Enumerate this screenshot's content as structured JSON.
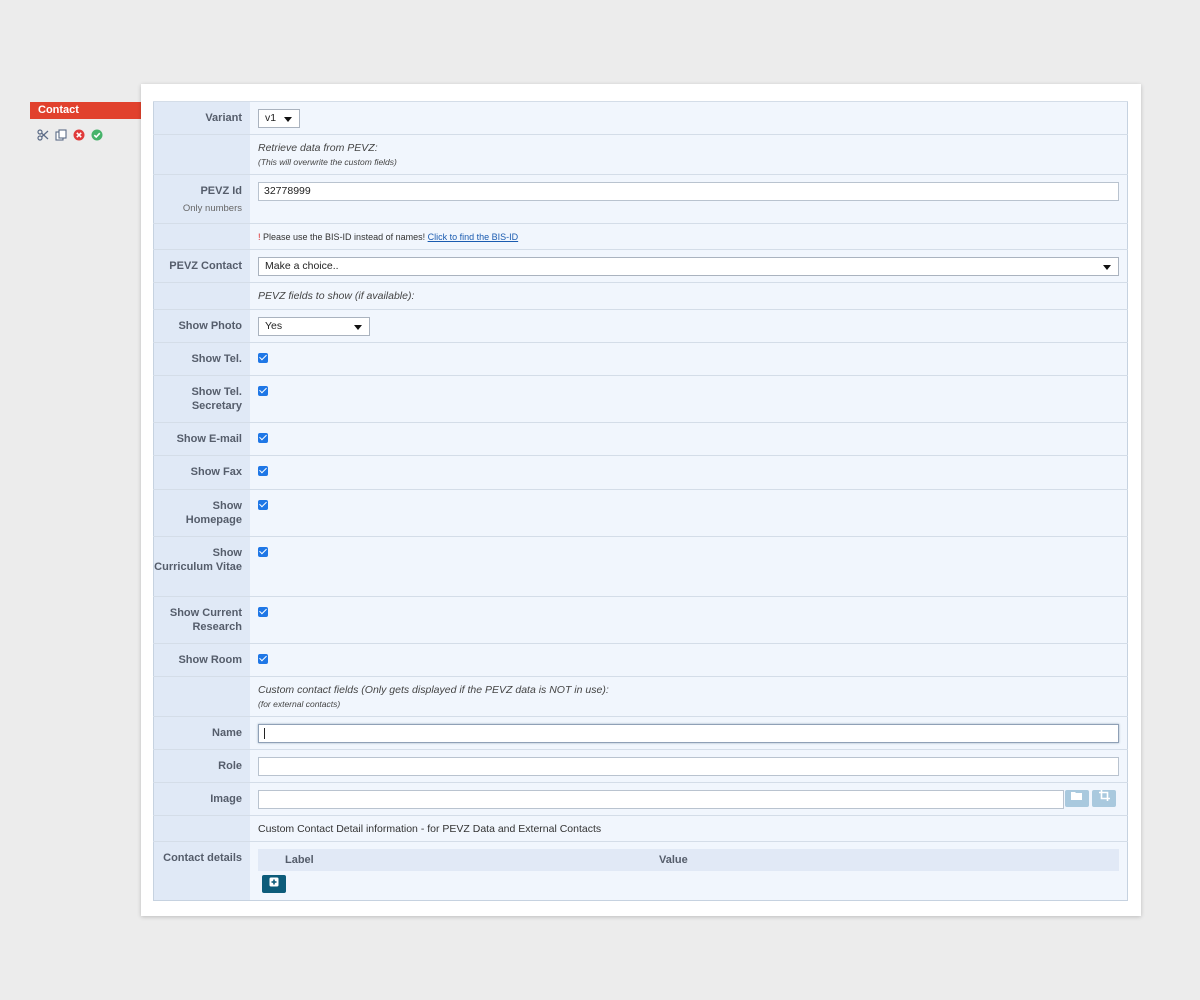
{
  "sidebar": {
    "tag_label": "Contact",
    "tools": [
      "scissors-icon",
      "copy-icon",
      "delete-icon",
      "confirm-icon"
    ]
  },
  "form": {
    "variant": {
      "label": "Variant",
      "value": "v1"
    },
    "retrieve": {
      "line1": "Retrieve data from PEVZ:",
      "line2": "(This will overwrite the custom fields)"
    },
    "pevz_id": {
      "label": "PEVZ Id",
      "hint": "Only numbers",
      "value": "32778999"
    },
    "warning": {
      "bang": "!",
      "text": " Please use the BIS-ID instead of names! ",
      "link": "Click to find the BIS-ID"
    },
    "pevz_contact": {
      "label": "PEVZ Contact",
      "value": "Make a choice.."
    },
    "pevz_fields_note": "PEVZ fields to show (if available):",
    "show_photo": {
      "label": "Show Photo",
      "value": "Yes"
    },
    "checkboxes": [
      {
        "label": "Show Tel.",
        "checked": true
      },
      {
        "label": "Show Tel. Secretary",
        "checked": true
      },
      {
        "label": "Show E-mail",
        "checked": true
      },
      {
        "label": "Show Fax",
        "checked": true
      },
      {
        "label": "Show Homepage",
        "checked": true
      },
      {
        "label": "Show Curriculum Vitae",
        "checked": true
      },
      {
        "label": "Show Current Research",
        "checked": true
      },
      {
        "label": "Show Room",
        "checked": true
      }
    ],
    "custom_note": {
      "line1": "Custom contact fields (Only gets displayed if the PEVZ data is NOT in use):",
      "line2": "(for external contacts)"
    },
    "name": {
      "label": "Name",
      "value": ""
    },
    "role": {
      "label": "Role",
      "value": ""
    },
    "image": {
      "label": "Image",
      "value": ""
    },
    "detail_note": "Custom Contact Detail information - for PEVZ Data and External Contacts",
    "contact_details": {
      "label": "Contact details",
      "col_label": "Label",
      "col_value": "Value"
    }
  }
}
